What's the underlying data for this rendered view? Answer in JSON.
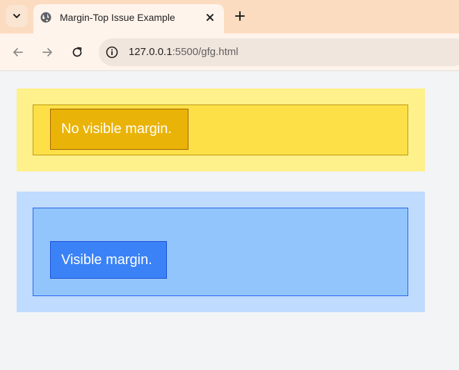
{
  "browser": {
    "tab": {
      "title": "Margin-Top Issue Example",
      "favicon": "globe-icon"
    },
    "address": {
      "host": "127.0.0.1",
      "path": ":5500/gfg.html"
    },
    "icons": {
      "tab_menu": "chevron-down-icon",
      "close": "close-icon",
      "new_tab": "plus-icon",
      "back": "arrow-left-icon",
      "forward": "arrow-right-icon",
      "reload": "reload-icon",
      "site_info": "info-icon"
    }
  },
  "page": {
    "examples": [
      {
        "label": "No visible margin."
      },
      {
        "label": "Visible margin."
      }
    ]
  },
  "colors": {
    "yellow_outer": "#fef08a",
    "yellow_inner": "#fde047",
    "yellow_child": "#eab308",
    "blue_outer": "#bfdbfe",
    "blue_inner": "#93c5fd",
    "blue_child": "#3b82f6"
  }
}
